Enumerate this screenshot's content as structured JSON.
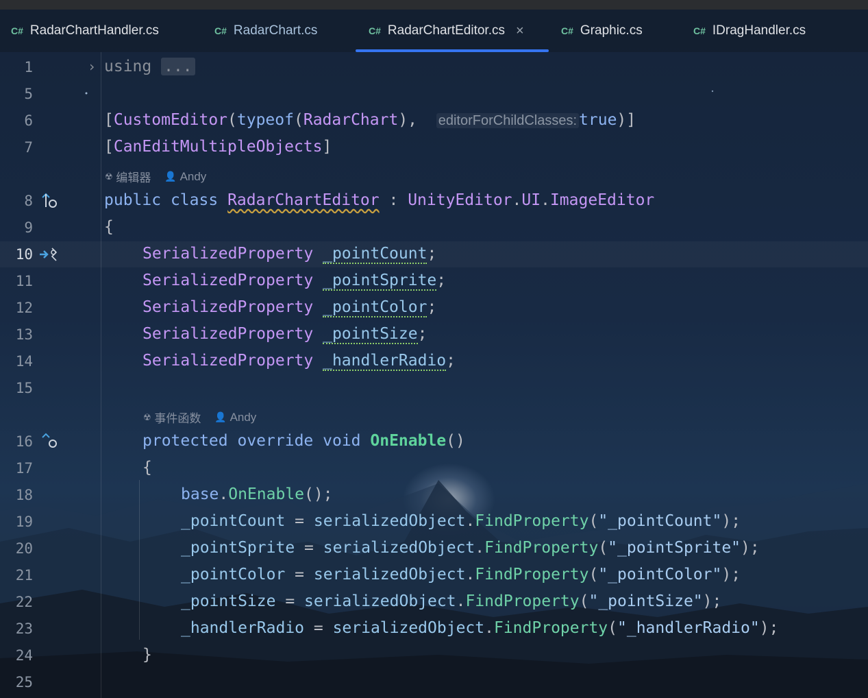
{
  "tabs": [
    {
      "label": "RadarChartHandler.cs",
      "lang": "C#"
    },
    {
      "label": "RadarChart.cs",
      "lang": "C#"
    },
    {
      "label": "RadarChartEditor.cs",
      "lang": "C#",
      "close": "×"
    },
    {
      "label": "Graphic.cs",
      "lang": "C#"
    },
    {
      "label": "IDragHandler.cs",
      "lang": "C#"
    }
  ],
  "line_numbers": [
    "1",
    "5",
    "6",
    "7",
    "8",
    "9",
    "10",
    "11",
    "12",
    "13",
    "14",
    "15",
    "16",
    "17",
    "18",
    "19",
    "20",
    "21",
    "22",
    "23",
    "24",
    "25"
  ],
  "hints": {
    "class_usage": "编辑器",
    "class_author": "Andy",
    "method_usage": "事件函数",
    "method_author": "Andy"
  },
  "code": {
    "l1_kw": "using",
    "l1_folded": "...",
    "l6_attr": "CustomEditor",
    "l6_typeof": "typeof",
    "l6_type": "RadarChart",
    "l6_param_hint": "editorForChildClasses:",
    "l6_true": "true",
    "l7_attr": "CanEditMultipleObjects",
    "l8_public": "public",
    "l8_class": "class",
    "l8_name": "RadarChartEditor",
    "l8_colon": ":",
    "l8_ns1": "UnityEditor",
    "l8_ns2": "UI",
    "l8_base": "ImageEditor",
    "brace_open": "{",
    "brace_close": "}",
    "field_type": "SerializedProperty",
    "fields": [
      "_pointCount",
      "_pointSprite",
      "_pointColor",
      "_pointSize",
      "_handlerRadio"
    ],
    "l16_protected": "protected",
    "l16_override": "override",
    "l16_void": "void",
    "l16_name": "OnEnable",
    "l16_parens": "()",
    "l18_base": "base",
    "l18_call": "OnEnable",
    "serialized_object": "serializedObject",
    "find_property": "FindProperty",
    "strings": [
      "\"_pointCount\"",
      "\"_pointSprite\"",
      "\"_pointColor\"",
      "\"_pointSize\"",
      "\"_handlerRadio\""
    ]
  },
  "colors": {
    "keyword": "#8db3f0",
    "type": "#c597f5",
    "method": "#6fd2a8",
    "field": "#98c7ea",
    "string": "#a8ccf0",
    "tab_accent": "#3574f0"
  },
  "icons": [
    "chevron-right-icon",
    "implemented-icon",
    "bookmark-arrow-icon",
    "override-icon",
    "close-icon",
    "usages-icon",
    "author-icon"
  ]
}
